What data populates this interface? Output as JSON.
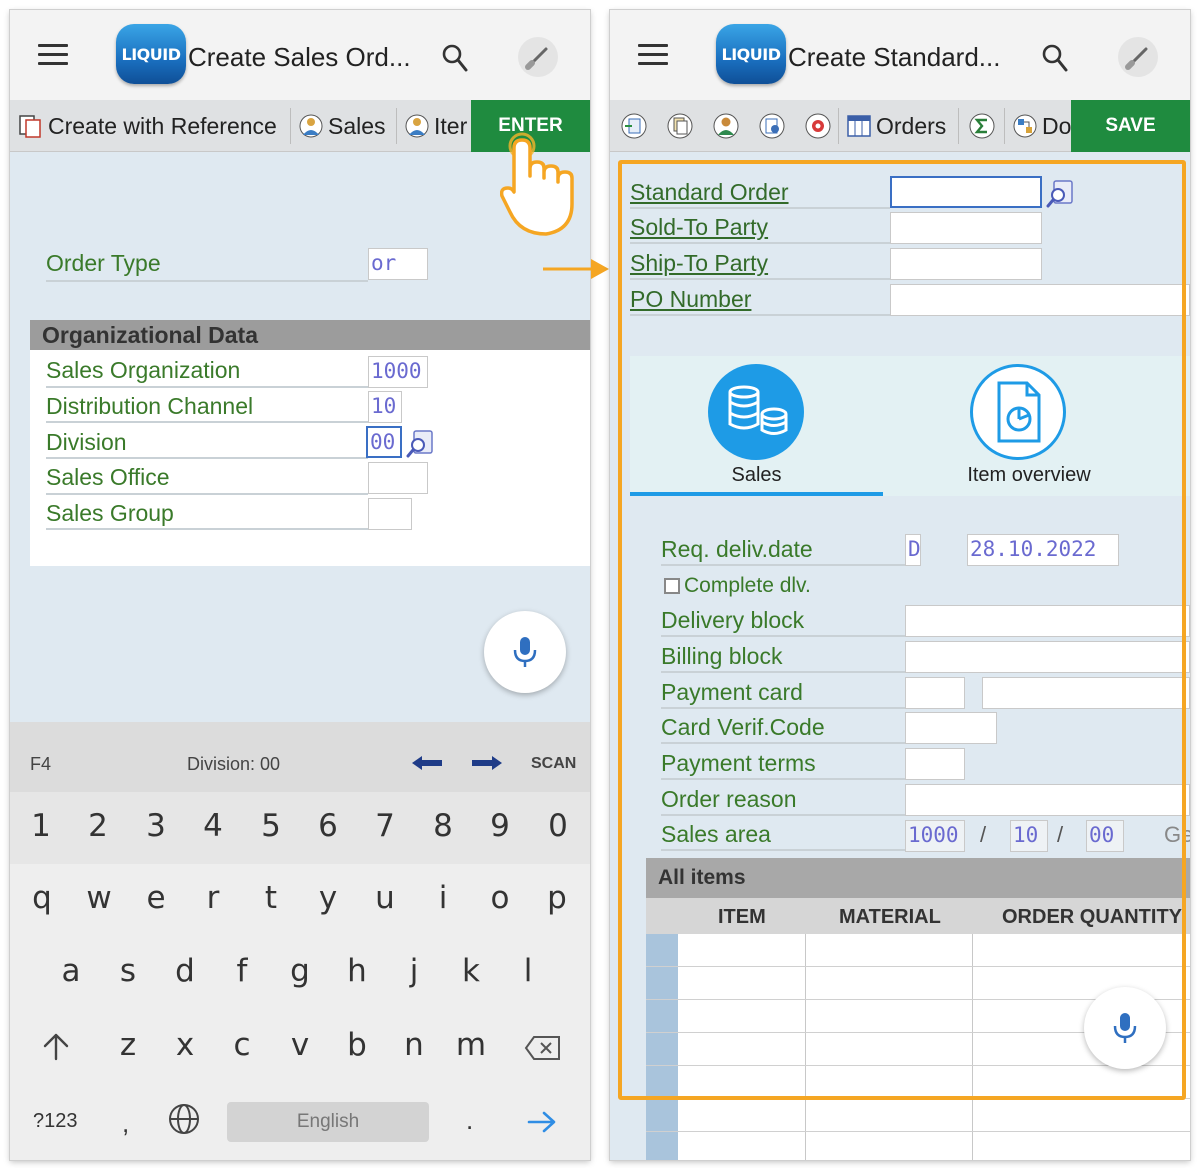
{
  "left": {
    "app_title": "Create Sales Ord...",
    "logo_text": "LIQUID",
    "toolbar": {
      "create_with_reference": "Create with Reference",
      "sales": "Sales",
      "item_partial": "Iter",
      "enter": "ENTER"
    },
    "order_type": {
      "label": "Order Type",
      "value": "or"
    },
    "org_section": {
      "title": "Organizational Data",
      "fields": [
        {
          "label": "Sales Organization",
          "value": "1000"
        },
        {
          "label": "Distribution Channel",
          "value": "10"
        },
        {
          "label": "Division",
          "value": "00"
        },
        {
          "label": "Sales Office",
          "value": ""
        },
        {
          "label": "Sales Group",
          "value": ""
        }
      ]
    },
    "keyboard": {
      "status": {
        "fkey": "F4",
        "hint": "Division: 00",
        "scan": "SCAN"
      },
      "numbers": [
        "1",
        "2",
        "3",
        "4",
        "5",
        "6",
        "7",
        "8",
        "9",
        "0"
      ],
      "row1": [
        "q",
        "w",
        "e",
        "r",
        "t",
        "y",
        "u",
        "i",
        "o",
        "p"
      ],
      "row2": [
        "a",
        "s",
        "d",
        "f",
        "g",
        "h",
        "j",
        "k",
        "l"
      ],
      "row3": [
        "z",
        "x",
        "c",
        "v",
        "b",
        "n",
        "m"
      ],
      "mode_key": "?123",
      "comma": ",",
      "space": "English",
      "period": "."
    }
  },
  "right": {
    "app_title": "Create Standard...",
    "logo_text": "LIQUID",
    "toolbar": {
      "orders": "Orders",
      "doc_partial": "Do",
      "save": "SAVE"
    },
    "header_fields": [
      {
        "label": "Standard Order",
        "value": ""
      },
      {
        "label": "Sold-To Party",
        "value": ""
      },
      {
        "label": "Ship-To Party",
        "value": ""
      },
      {
        "label": "PO Number",
        "value": ""
      }
    ],
    "tabs": [
      {
        "label": "Sales",
        "icon": "coins-icon",
        "active": true
      },
      {
        "label": "Item overview",
        "icon": "document-chart-icon",
        "active": false
      }
    ],
    "sales_fields": {
      "req_deliv_date": {
        "label": "Req. deliv.date",
        "format": "D",
        "value": "28.10.2022"
      },
      "complete_dlv": "Complete dlv.",
      "delivery_block": "Delivery block",
      "billing_block": "Billing block",
      "payment_card": "Payment card",
      "card_verif_code": "Card Verif.Code",
      "payment_terms": "Payment terms",
      "order_reason": "Order reason",
      "sales_area": {
        "label": "Sales area",
        "org": "1000",
        "sep1": "/",
        "channel": "10",
        "sep2": "/",
        "division": "00",
        "desc_partial": "Ger"
      }
    },
    "items": {
      "title": "All items",
      "columns": [
        "ITEM",
        "MATERIAL",
        "ORDER QUANTITY"
      ]
    }
  },
  "colors": {
    "action_green": "#1f8b3f",
    "label_green": "#3a7a2a",
    "highlight_orange": "#f5a623",
    "tab_blue": "#1e9be6",
    "background": "#dfe9f1"
  }
}
